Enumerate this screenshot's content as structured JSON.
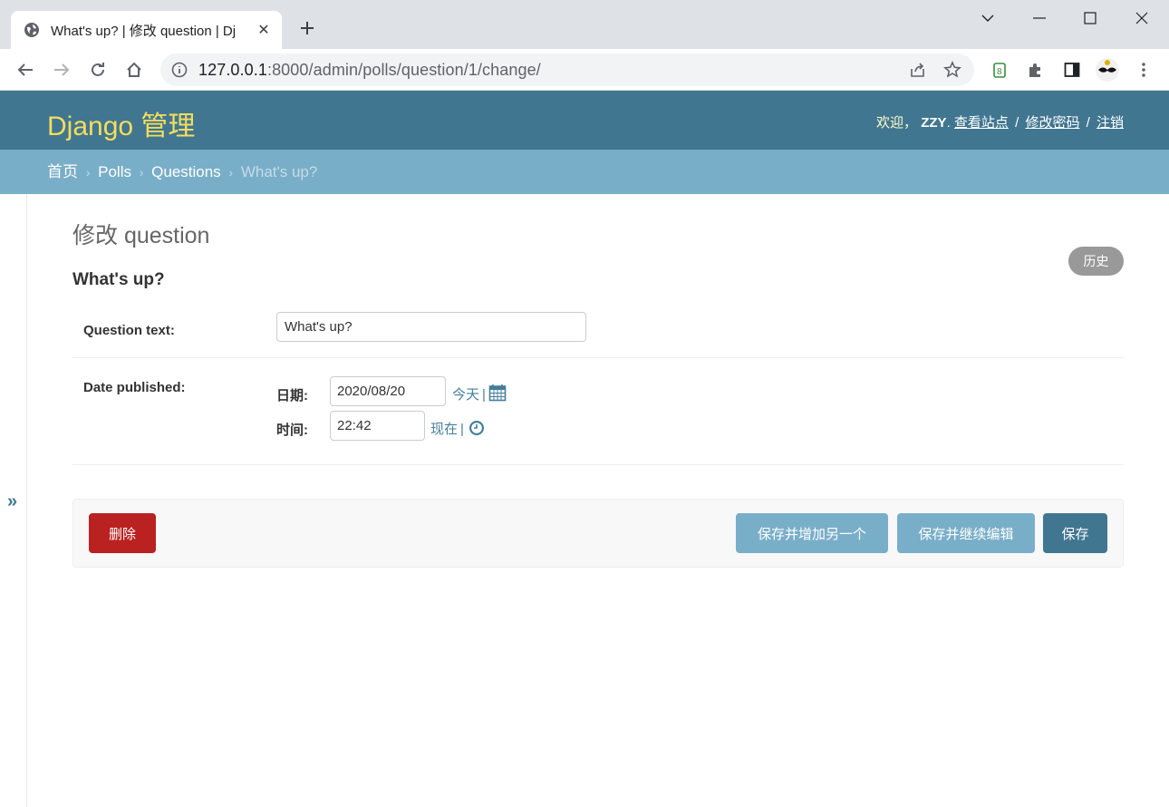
{
  "browser": {
    "tab_title": "What's up? | 修改 question | Dj",
    "url_host": "127.0.0.1",
    "url_path": ":8000/admin/polls/question/1/change/"
  },
  "header": {
    "branding": "Django 管理",
    "welcome": "欢迎，",
    "username": "ZZY",
    "username_suffix": ".",
    "view_site": "查看站点",
    "change_password": "修改密码",
    "logout": "注销",
    "separator": "/"
  },
  "breadcrumbs": {
    "home": "首页",
    "app": "Polls",
    "model": "Questions",
    "current": "What's up?",
    "arrow": "›"
  },
  "sidebar": {
    "toggle": "»"
  },
  "content": {
    "title": "修改 question",
    "history": "历史",
    "object_title": "What's up?"
  },
  "form": {
    "question_text_label": "Question text:",
    "question_text_value": "What's up?",
    "date_published_label": "Date published:",
    "date_label": "日期:",
    "date_value": "2020/08/20",
    "today": "今天",
    "time_label": "时间:",
    "time_value": "22:42",
    "now": "现在",
    "bar": "|"
  },
  "submit": {
    "delete": "删除",
    "save_add_another": "保存并增加另一个",
    "save_continue": "保存并继续编辑",
    "save": "保存"
  },
  "colors": {
    "header_bg": "#417690",
    "breadcrumb_bg": "#79aec8",
    "branding": "#f5dd5d",
    "delete_bg": "#ba2121",
    "save_bg": "#417690"
  }
}
